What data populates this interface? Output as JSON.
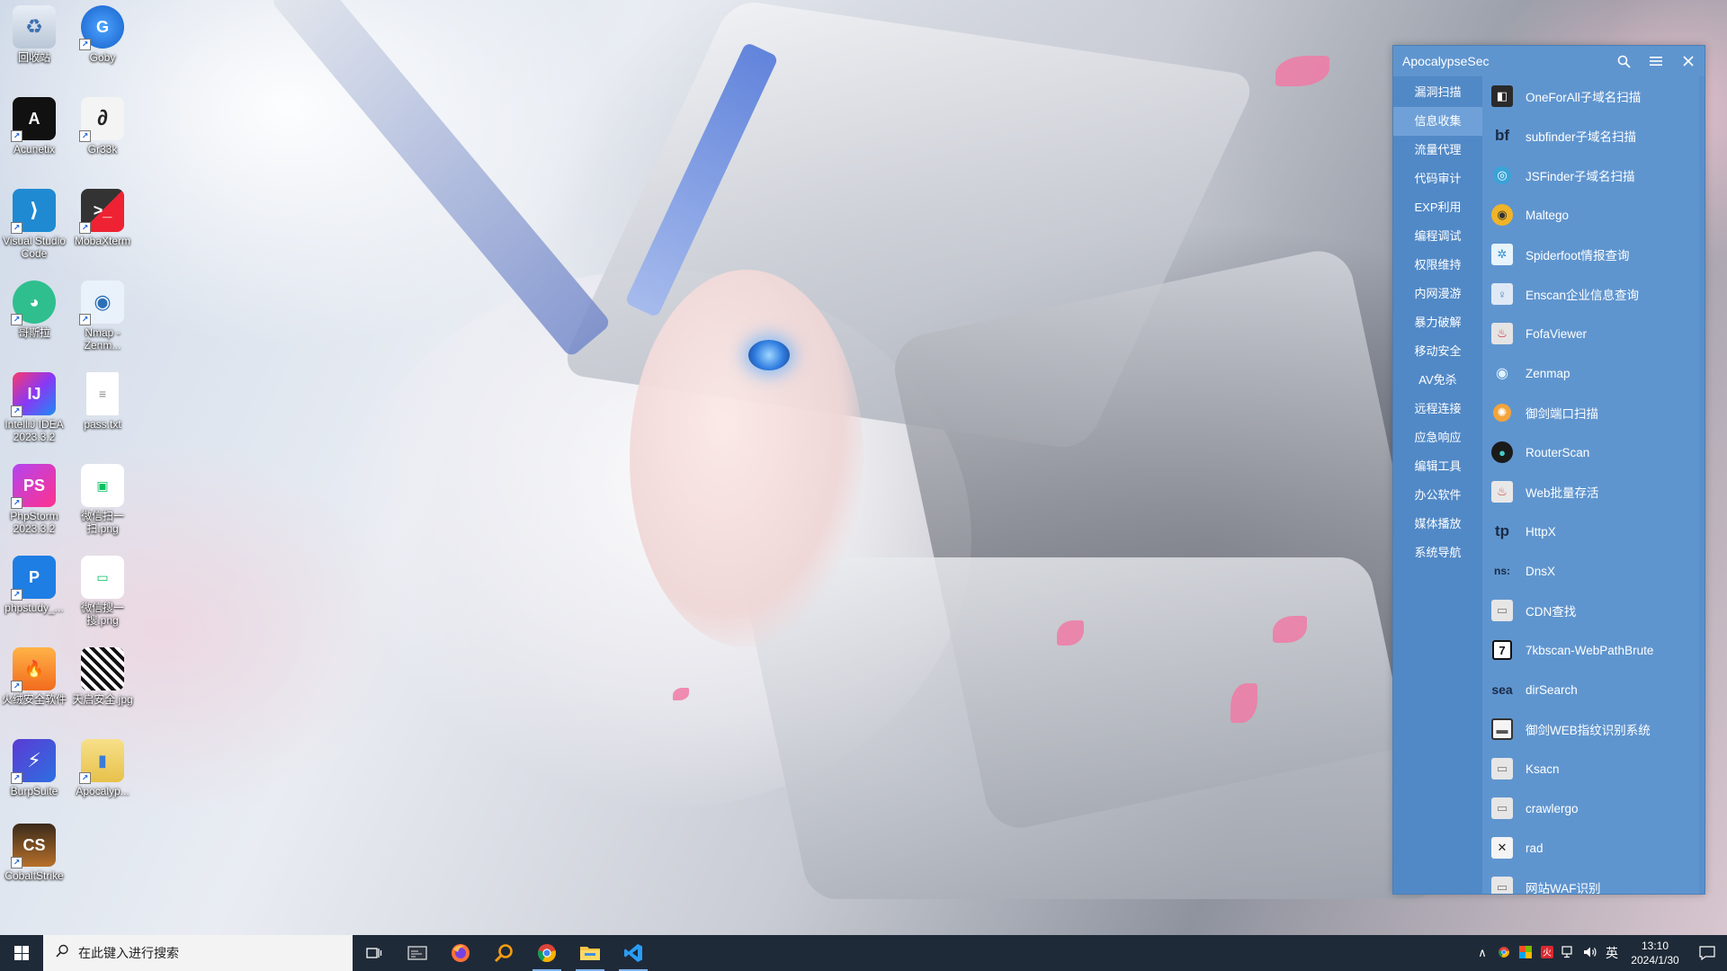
{
  "desktop": {
    "icons": [
      {
        "label": "回收站"
      },
      {
        "label": "Goby"
      },
      {
        "label": "Acunetix"
      },
      {
        "label": "Gr33k"
      },
      {
        "label": "Visual Studio Code"
      },
      {
        "label": "MobaXterm"
      },
      {
        "label": "哥斯拉"
      },
      {
        "label": "Nmap - Zenm..."
      },
      {
        "label": "IntelliJ IDEA 2023.3.2"
      },
      {
        "label": "pass.txt"
      },
      {
        "label": "PhpStorm 2023.3.2"
      },
      {
        "label": "微信扫一扫.png"
      },
      {
        "label": "phpstudy_..."
      },
      {
        "label": "微信搜一搜.png"
      },
      {
        "label": "火绒安全软件"
      },
      {
        "label": "天启安全.jpg"
      },
      {
        "label": "BurpSuite"
      },
      {
        "label": "Apocalyp..."
      },
      {
        "label": "CobaltStrike"
      }
    ]
  },
  "app": {
    "title": "ApocalypseSec",
    "search_icon": "search-icon",
    "menu_icon": "hamburger-icon",
    "close_icon": "close-icon",
    "categories": [
      {
        "label": "漏洞扫描"
      },
      {
        "label": "信息收集"
      },
      {
        "label": "流量代理"
      },
      {
        "label": "代码审计"
      },
      {
        "label": "EXP利用"
      },
      {
        "label": "编程调试"
      },
      {
        "label": "权限维持"
      },
      {
        "label": "内网漫游"
      },
      {
        "label": "暴力破解"
      },
      {
        "label": "移动安全"
      },
      {
        "label": "AV免杀"
      },
      {
        "label": "远程连接"
      },
      {
        "label": "应急响应"
      },
      {
        "label": "编辑工具"
      },
      {
        "label": "办公软件"
      },
      {
        "label": "媒体播放"
      },
      {
        "label": "系统导航"
      }
    ],
    "active_category": "信息收集",
    "tools": [
      {
        "label": "OneForAll子域名扫描",
        "icon_text": ""
      },
      {
        "label": "subfinder子域名扫描",
        "icon_text": "bf"
      },
      {
        "label": "JSFinder子域名扫描",
        "icon_text": ""
      },
      {
        "label": "Maltego",
        "icon_text": ""
      },
      {
        "label": "Spiderfoot情报查询",
        "icon_text": ""
      },
      {
        "label": "Enscan企业信息查询",
        "icon_text": ""
      },
      {
        "label": "FofaViewer",
        "icon_text": ""
      },
      {
        "label": "Zenmap",
        "icon_text": ""
      },
      {
        "label": "御剑端口扫描",
        "icon_text": ""
      },
      {
        "label": "RouterScan",
        "icon_text": ""
      },
      {
        "label": "Web批量存活",
        "icon_text": ""
      },
      {
        "label": "HttpX",
        "icon_text": "tp"
      },
      {
        "label": "DnsX",
        "icon_text": "ns:"
      },
      {
        "label": "CDN查找",
        "icon_text": ""
      },
      {
        "label": "7kbscan-WebPathBrute",
        "icon_text": "7"
      },
      {
        "label": "dirSearch",
        "icon_text": "sea"
      },
      {
        "label": "御剑WEB指纹识别系统",
        "icon_text": ""
      },
      {
        "label": "Ksacn",
        "icon_text": ""
      },
      {
        "label": "crawlergo",
        "icon_text": ""
      },
      {
        "label": "rad",
        "icon_text": ""
      },
      {
        "label": "网站WAF识别",
        "icon_text": ""
      }
    ]
  },
  "taskbar": {
    "search_placeholder": "在此键入进行搜索",
    "pinned": [
      {
        "name": "task-view-icon"
      },
      {
        "name": "terminal-icon"
      },
      {
        "name": "firefox-icon"
      },
      {
        "name": "search-tool-icon"
      },
      {
        "name": "chrome-icon"
      },
      {
        "name": "file-explorer-icon"
      },
      {
        "name": "vscode-icon"
      }
    ],
    "tray": {
      "ime": "英",
      "time": "13:10",
      "date": "2024/1/30"
    }
  }
}
